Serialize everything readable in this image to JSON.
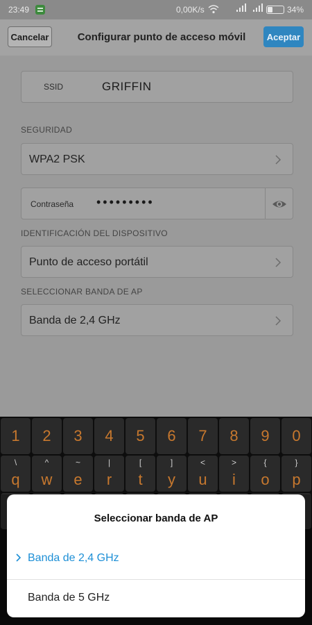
{
  "status_bar": {
    "time": "23:49",
    "net_speed": "0,00K/s",
    "battery_percent_label": "34%",
    "battery_level": 0.34
  },
  "header": {
    "cancel_label": "Cancelar",
    "title": "Configurar punto de acceso móvil",
    "accept_label": "Aceptar",
    "accent_color": "#2f86c0"
  },
  "form": {
    "ssid_label": "SSID",
    "ssid_value": "GRIFFIN",
    "security_section": "SEGURIDAD",
    "security_value": "WPA2 PSK",
    "password_label": "Contraseña",
    "password_value": "•••••••••",
    "device_id_section": "IDENTIFICACIÓN DEL DISPOSITIVO",
    "device_id_value": "Punto de acceso portátil",
    "band_section": "SELECCIONAR BANDA DE AP",
    "band_value": "Banda de 2,4 GHz"
  },
  "keyboard": {
    "number_row": [
      "1",
      "2",
      "3",
      "4",
      "5",
      "6",
      "7",
      "8",
      "9",
      "0"
    ],
    "letter_row": [
      {
        "main": "q",
        "sub": "\\"
      },
      {
        "main": "w",
        "sub": "^"
      },
      {
        "main": "e",
        "sub": "~"
      },
      {
        "main": "r",
        "sub": "|"
      },
      {
        "main": "t",
        "sub": "["
      },
      {
        "main": "y",
        "sub": "]"
      },
      {
        "main": "u",
        "sub": "<"
      },
      {
        "main": "i",
        "sub": ">"
      },
      {
        "main": "o",
        "sub": "{"
      },
      {
        "main": "p",
        "sub": "}"
      }
    ]
  },
  "dialog": {
    "title": "Seleccionar banda de AP",
    "options": [
      {
        "label": "Banda de 2,4 GHz",
        "selected": true
      },
      {
        "label": "Banda de 5 GHz",
        "selected": false
      }
    ],
    "selected_color": "#1d8fd6"
  }
}
